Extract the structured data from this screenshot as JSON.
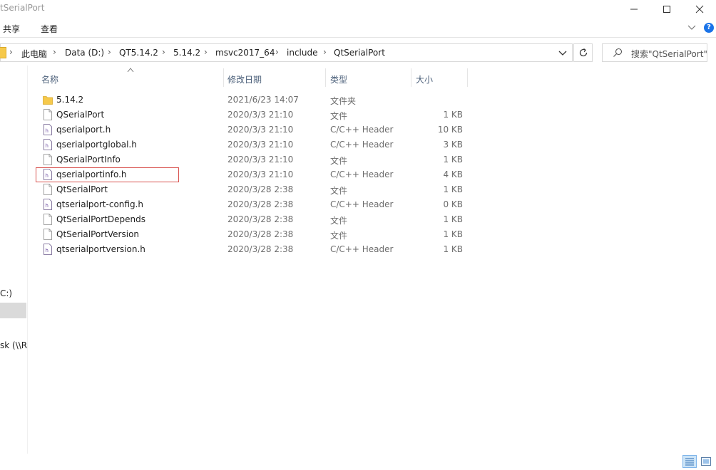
{
  "window": {
    "title": "tSerialPort"
  },
  "ribbon": {
    "tabs": [
      {
        "label": "共享"
      },
      {
        "label": "查看"
      }
    ],
    "help_glyph": "?"
  },
  "address": {
    "crumbs": [
      "此电脑",
      "Data (D:)",
      "QT5.14.2",
      "5.14.2",
      "msvc2017_64",
      "include",
      "QtSerialPort"
    ],
    "separator": "›"
  },
  "search": {
    "placeholder": "搜索\"QtSerialPort\""
  },
  "nav": {
    "items": [
      {
        "label": "C:)"
      },
      {
        "label": "sk (\\\\R"
      }
    ]
  },
  "columns": {
    "name": "名称",
    "date": "修改日期",
    "type": "类型",
    "size": "大小"
  },
  "files": [
    {
      "name": "5.14.2",
      "date": "2021/6/23 14:07",
      "type": "文件夹",
      "size": "",
      "icon": "folder-icon"
    },
    {
      "name": "QSerialPort",
      "date": "2020/3/3 21:10",
      "type": "文件",
      "size": "1 KB",
      "icon": "file-icon"
    },
    {
      "name": "qserialport.h",
      "date": "2020/3/3 21:10",
      "type": "C/C++ Header",
      "size": "10 KB",
      "icon": "header-file-icon"
    },
    {
      "name": "qserialportglobal.h",
      "date": "2020/3/3 21:10",
      "type": "C/C++ Header",
      "size": "3 KB",
      "icon": "header-file-icon"
    },
    {
      "name": "QSerialPortInfo",
      "date": "2020/3/3 21:10",
      "type": "文件",
      "size": "1 KB",
      "icon": "file-icon"
    },
    {
      "name": "qserialportinfo.h",
      "date": "2020/3/3 21:10",
      "type": "C/C++ Header",
      "size": "4 KB",
      "icon": "header-file-icon"
    },
    {
      "name": "QtSerialPort",
      "date": "2020/3/28 2:38",
      "type": "文件",
      "size": "1 KB",
      "icon": "file-icon"
    },
    {
      "name": "qtserialport-config.h",
      "date": "2020/3/28 2:38",
      "type": "C/C++ Header",
      "size": "0 KB",
      "icon": "header-file-icon"
    },
    {
      "name": "QtSerialPortDepends",
      "date": "2020/3/28 2:38",
      "type": "文件",
      "size": "1 KB",
      "icon": "file-icon"
    },
    {
      "name": "QtSerialPortVersion",
      "date": "2020/3/28 2:38",
      "type": "文件",
      "size": "1 KB",
      "icon": "file-icon"
    },
    {
      "name": "qtserialportversion.h",
      "date": "2020/3/28 2:38",
      "type": "C/C++ Header",
      "size": "1 KB",
      "icon": "header-file-icon"
    }
  ],
  "colors": {
    "highlight_border": "#d9534f",
    "folder": "#f6c94b",
    "accent": "#1a73e8"
  }
}
